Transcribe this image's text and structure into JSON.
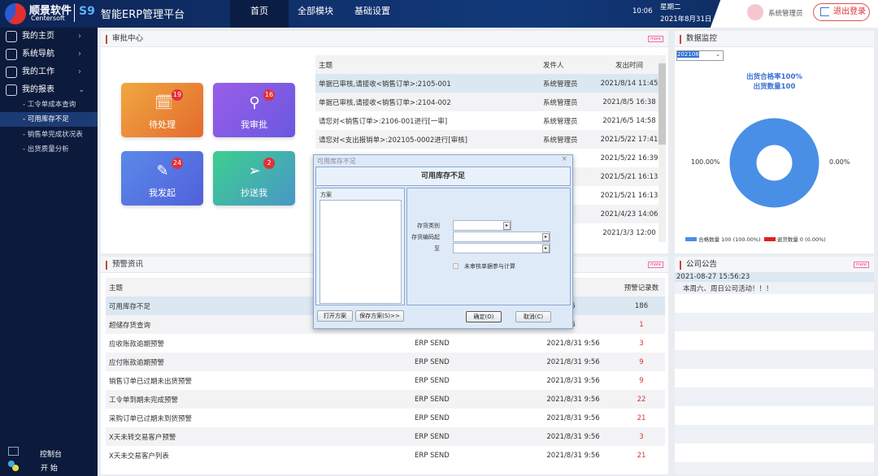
{
  "header": {
    "brand_cn": "顺景软件",
    "brand_en": "Centersoft",
    "product": "智能ERP管理平台",
    "product_logo": "S9",
    "nav": [
      "首页",
      "全部模块",
      "基础设置"
    ],
    "time": "10:06",
    "weekday": "星期二",
    "date": "2021年8月31日",
    "user": "系统管理员",
    "logout": "退出登录"
  },
  "sidebar": {
    "items": [
      {
        "label": "我的主页",
        "icon": "home-icon"
      },
      {
        "label": "系统导航",
        "icon": "map-pin-icon"
      },
      {
        "label": "我的工作",
        "icon": "briefcase-icon"
      },
      {
        "label": "我的报表",
        "icon": "chart-icon"
      }
    ],
    "subitems": [
      "工令单成本查询",
      "可用库存不足",
      "销售单完成状况表",
      "出货质量分析"
    ],
    "active_sub": "可用库存不足",
    "bottom": [
      "控制台",
      "开 始"
    ]
  },
  "approval": {
    "title": "审批中心",
    "more": "more",
    "tiles": [
      {
        "label": "待处理",
        "count": "19",
        "color": "#e8843a"
      },
      {
        "label": "我审批",
        "count": "16",
        "color": "#7a5ae6"
      },
      {
        "label": "我发起",
        "count": "24",
        "color": "#5a74e2"
      },
      {
        "label": "抄送我",
        "count": "2",
        "color": "#3ab89a"
      }
    ],
    "columns": [
      "主题",
      "发件人",
      "发出时间"
    ],
    "rows": [
      [
        "单据已审核,请接收<销售订单>:2105-001",
        "系统管理员",
        "2021/8/14 11:45"
      ],
      [
        "单据已审核,请接收<销售订单>:2104-002",
        "系统管理员",
        "2021/8/5 16:38"
      ],
      [
        "请您对<销售订单>:2106-001进行[一审]",
        "系统管理员",
        "2021/6/5 14:58"
      ],
      [
        "请您对<支出报销单>:202105-0002进行[审核]",
        "系统管理员",
        "2021/5/22 17:41"
      ],
      [
        "",
        "员",
        "2021/5/22 16:39"
      ],
      [
        "",
        "员",
        "2021/5/21 16:13"
      ],
      [
        "",
        "员",
        "2021/5/21 16:13"
      ],
      [
        "",
        "员",
        "2021/4/23 14:06"
      ],
      [
        "",
        "员",
        "2021/3/3 12:00"
      ]
    ]
  },
  "warning": {
    "title": "预警资讯",
    "more": "more",
    "columns": [
      "主题",
      "",
      "",
      "预警记录数"
    ],
    "rows": [
      [
        "可用库存不足",
        "",
        "6",
        "186"
      ],
      [
        "超储存货查询",
        "",
        "6",
        "1"
      ],
      [
        "应收账款逾期预警",
        "ERP SEND",
        "2021/8/31 9:56",
        "3"
      ],
      [
        "应付账款逾期预警",
        "ERP SEND",
        "2021/8/31 9:56",
        "9"
      ],
      [
        "销售订单已过期未出货预警",
        "ERP SEND",
        "2021/8/31 9:56",
        "9"
      ],
      [
        "工令单到期未完成预警",
        "ERP SEND",
        "2021/8/31 9:56",
        "22"
      ],
      [
        "采购订单已过期未到货预警",
        "ERP SEND",
        "2021/8/31 9:56",
        "21"
      ],
      [
        "X天未转交易客户预警",
        "ERP SEND",
        "2021/8/31 9:56",
        "3"
      ],
      [
        "X天未交易客户列表",
        "ERP SEND",
        "2021/8/31 9:56",
        "21"
      ]
    ]
  },
  "monitor": {
    "title": "数据监控",
    "period": "202108",
    "line1": "出货合格率100%",
    "line2": "出货数量100",
    "label_left": "100.00%",
    "label_right": "0.00%",
    "legend": [
      {
        "name": "合格数量",
        "detail": "100 (100.00%)",
        "color": "#4a8fe6"
      },
      {
        "name": "退货数量",
        "detail": "0 (0.00%)",
        "color": "#e02020"
      }
    ]
  },
  "chart_data": {
    "type": "pie",
    "donut": true,
    "categories": [
      "合格数量",
      "退货数量"
    ],
    "values": [
      100,
      0
    ],
    "colors": [
      "#4a8fe6",
      "#e02020"
    ],
    "title": "出货合格率100%",
    "subtitle": "出货数量100",
    "legend": "bottom"
  },
  "notice": {
    "title": "公司公告",
    "more": "more",
    "time": "2021-08-27 15:56:23",
    "text": "本周六、周日公司活动！！！"
  },
  "dialog": {
    "window_title": "可用库存不足",
    "heading": "可用库存不足",
    "scheme_label": "方案",
    "fields": [
      "存货类别",
      "存货编码起",
      "至"
    ],
    "checkbox": "未审核单据参与计算",
    "open": "打开方案",
    "save": "保存方案(S)>>",
    "ok": "确定(O)",
    "cancel": "取消(C)",
    "close": "×"
  }
}
